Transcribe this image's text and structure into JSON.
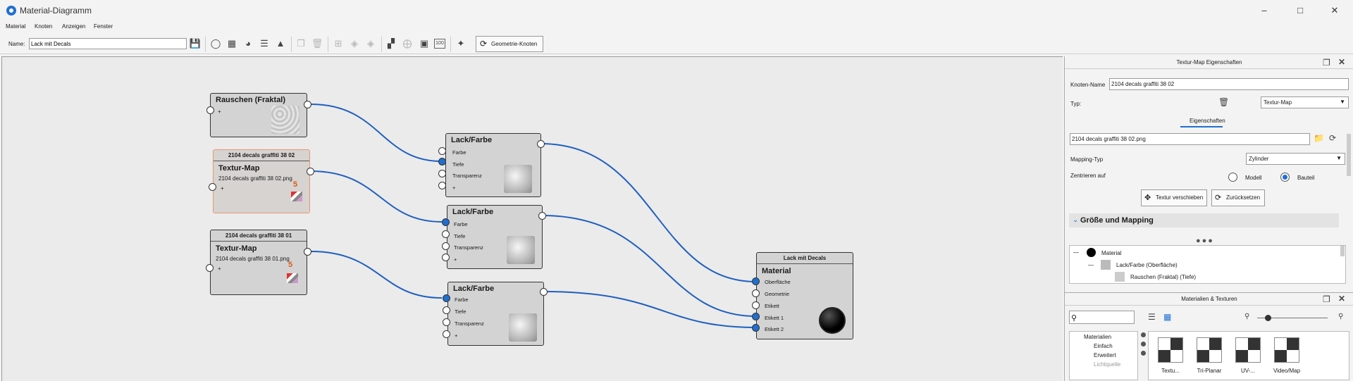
{
  "window": {
    "title": "Material-Diagramm",
    "minimize_icon": "minimize-icon",
    "maximize_icon": "maximize-icon",
    "close_icon": "close-icon"
  },
  "menu": [
    "Material",
    "Knoten",
    "Anzeigen",
    "Fenster"
  ],
  "toolbar": {
    "name_label": "Name:",
    "name_value": "Lack mit Decals",
    "geometry_button": "Geometrie-Knoten",
    "zoom_button": "100"
  },
  "nodes": {
    "noise": {
      "title": "Rauschen (Fraktal)",
      "plus": "+"
    },
    "texmap1": {
      "header": "2104 decals graffiti 38 02",
      "title": "Textur-Map",
      "file": "2104 decals graffiti 38 02.png",
      "plus": "+"
    },
    "texmap2": {
      "header": "2104 decals graffiti 38 01",
      "title": "Textur-Map",
      "file": "2104 decals graffiti 38 01.png",
      "plus": "+"
    },
    "lack": {
      "title": "Lack/Farbe",
      "p1": "Farbe",
      "p2": "Tiefe",
      "p3": "Transparenz",
      "p4": "+"
    },
    "material": {
      "header": "Lack mit Decals",
      "title": "Material",
      "p1": "Oberfläche",
      "p2": "Geometrie",
      "p3": "Etikett",
      "p4": "Etikett 1",
      "p5": "Etikett 2"
    }
  },
  "props": {
    "title": "Textur-Map Eigenschaften",
    "node_name_label": "Knoten-Name",
    "node_name_value": "2104 decals graffiti 38 02",
    "type_label": "Typ:",
    "type_value": "Textur-Map",
    "tab": "Eigenschaften",
    "file_value": "2104 decals graffiti 38 02.png",
    "mapping_label": "Mapping-Typ",
    "mapping_value": "Zylinder",
    "center_label": "Zentrieren auf",
    "radio_model": "Modell",
    "radio_part": "Bauteil",
    "btn_move": "Textur verschieben",
    "btn_reset": "Zurücksetzen",
    "section": "Größe und Mapping",
    "tree": [
      "Material",
      "Lack/Farbe (Oberfläche)",
      "Rauschen (Fraktal) (Tiefe)"
    ]
  },
  "mats": {
    "title": "Materialien & Texturen",
    "tree": [
      "Materialien",
      "Einfach",
      "Erweitert",
      "Lichtquelle"
    ],
    "tiles": [
      "Textu...",
      "Tri-Planar",
      "UV-...",
      "Video/Map"
    ]
  }
}
